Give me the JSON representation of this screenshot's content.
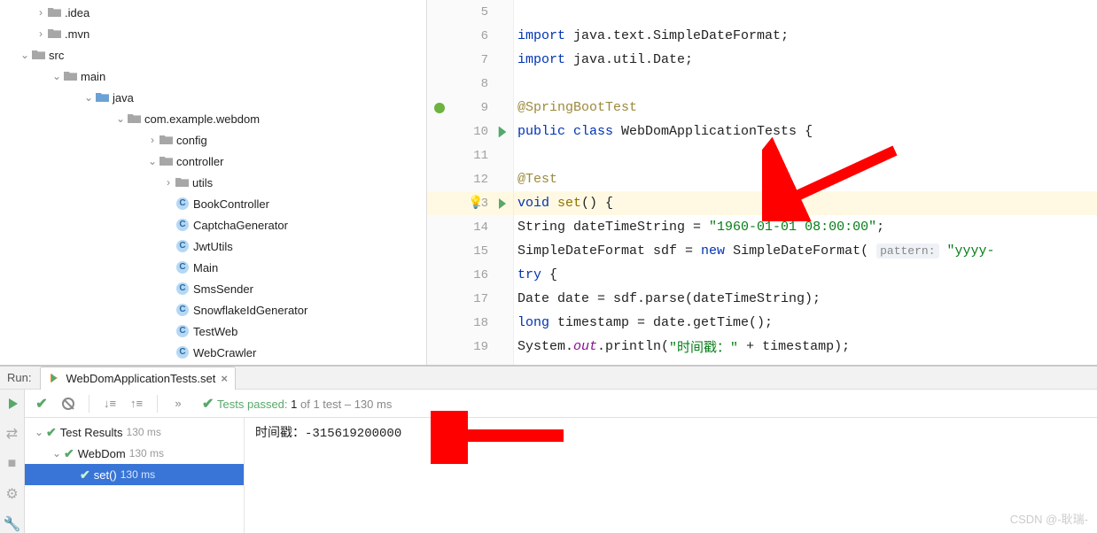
{
  "tree": {
    "idea": ".idea",
    "mvn": ".mvn",
    "src": "src",
    "main": "main",
    "java": "java",
    "pkg": "com.example.webdom",
    "config": "config",
    "controller": "controller",
    "utils": "utils",
    "files": [
      "BookController",
      "CaptchaGenerator",
      "JwtUtils",
      "Main",
      "SmsSender",
      "SnowflakeIdGenerator",
      "TestWeb",
      "WebCrawler"
    ]
  },
  "editor": {
    "line_numbers": [
      "5",
      "6",
      "7",
      "8",
      "9",
      "10",
      "11",
      "12",
      "13",
      "14",
      "15",
      "16",
      "17",
      "18",
      "19"
    ],
    "tokens": {
      "import1_a": "import ",
      "import1_b": "java.text.SimpleDateFormat",
      "import2_a": "import ",
      "import2_b": "java.util.Date",
      "ann_sbt": "@SpringBootTest",
      "public": "public ",
      "class": "class ",
      "classname": "WebDomApplicationTests",
      "ann_test": "@Test",
      "void": "void ",
      "method": "set",
      "paren": "() {",
      "l14_a": "String dateTimeString = ",
      "l14_str": "\"1960-01-01 08:00:00\"",
      "l15_a": "SimpleDateFormat sdf = ",
      "l15_new": "new ",
      "l15_b": "SimpleDateFormat( ",
      "l15_hint": "pattern:",
      "l15_c": " \"yyyy-",
      "l16": "try {",
      "try": "try ",
      "l17_a": "Date date = sdf.parse(dateTimeString);",
      "l18_a": "long ",
      "l18_b": "timestamp = date.getTime();",
      "l19_a": "System.",
      "l19_out": "out",
      "l19_b": ".println(",
      "l19_str": "\"时间戳：\"",
      "l19_c": " + timestamp);"
    }
  },
  "run": {
    "title": "Run:",
    "tab": "WebDomApplicationTests.set",
    "status_prefix": "Tests passed: ",
    "status_count": "1",
    "status_mid": " of 1 test",
    "status_time": " – 130 ms",
    "results_label": "Test Results",
    "results_time": "130 ms",
    "class_label": "WebDom",
    "class_time": "130 ms",
    "method_label": "set()",
    "method_time": "130 ms",
    "console_output": "时间戳：-315619200000"
  },
  "watermark": "CSDN @-耿瑞-"
}
